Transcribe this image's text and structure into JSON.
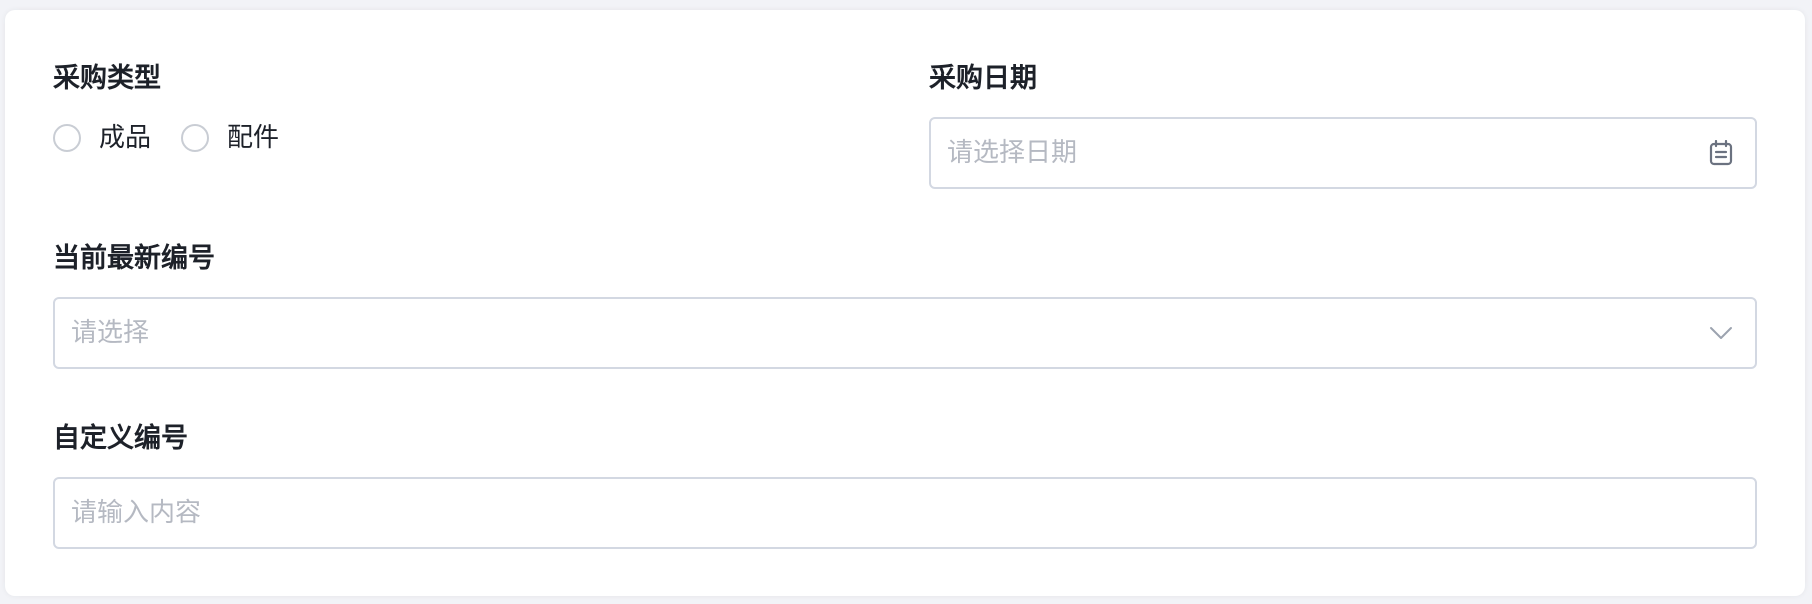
{
  "form": {
    "purchase_type": {
      "label": "采购类型",
      "options": [
        "成品",
        "配件"
      ]
    },
    "purchase_date": {
      "label": "采购日期",
      "placeholder": "请选择日期",
      "icon": "calendar-icon"
    },
    "current_latest_number": {
      "label": "当前最新编号",
      "placeholder": "请选择",
      "icon": "chevron-down-icon"
    },
    "custom_number": {
      "label": "自定义编号",
      "placeholder": "请输入内容"
    }
  }
}
